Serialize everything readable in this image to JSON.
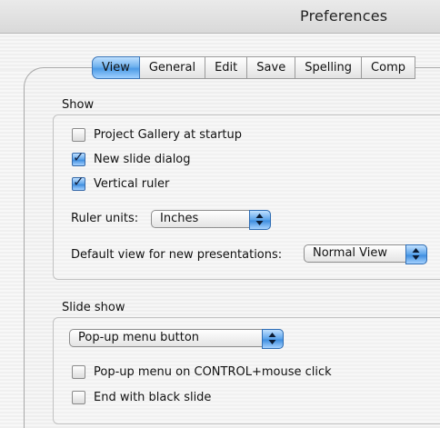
{
  "window": {
    "title": "Preferences"
  },
  "tabs": [
    {
      "label": "View",
      "selected": true
    },
    {
      "label": "General",
      "selected": false
    },
    {
      "label": "Edit",
      "selected": false
    },
    {
      "label": "Save",
      "selected": false
    },
    {
      "label": "Spelling",
      "selected": false
    },
    {
      "label": "Comp",
      "selected": false
    }
  ],
  "show": {
    "label": "Show",
    "checkboxes": [
      {
        "label": "Project Gallery at startup",
        "checked": false
      },
      {
        "label": "New slide dialog",
        "checked": true
      },
      {
        "label": "Vertical ruler",
        "checked": true
      }
    ],
    "ruler_units_label": "Ruler units:",
    "ruler_units_value": "Inches",
    "default_view_label": "Default view for new presentations:",
    "default_view_value": "Normal View"
  },
  "slide_show": {
    "label": "Slide show",
    "popup_value": "Pop-up menu button",
    "checkboxes": [
      {
        "label": "Pop-up menu on CONTROL+mouse click",
        "checked": false
      },
      {
        "label": "End with black slide",
        "checked": false
      }
    ]
  },
  "colors": {
    "accent": "#4d9be6",
    "panel_border": "#a9a9a9"
  },
  "icons": {
    "checkmark": "checkmark-icon",
    "popup_arrows": "updown-arrows-icon"
  }
}
